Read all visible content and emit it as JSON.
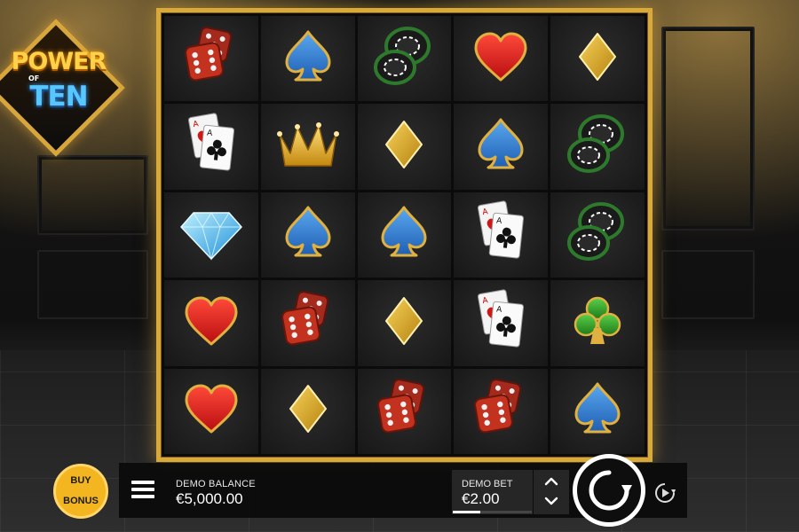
{
  "logo": {
    "line1": "POWER",
    "line2": "OF",
    "line3": "TEN"
  },
  "board": {
    "rows": [
      [
        "dice-icon",
        "spade-icon",
        "chips-icon",
        "heart-icon",
        "diamond-icon"
      ],
      [
        "cards-icon",
        "crown-icon",
        "diamond-icon",
        "spade-icon",
        "chips-icon"
      ],
      [
        "gem-icon",
        "spade-icon",
        "spade-icon",
        "cards-icon",
        "chips-icon"
      ],
      [
        "heart-icon",
        "dice-icon",
        "diamond-icon",
        "cards-icon",
        "club-icon"
      ],
      [
        "heart-icon",
        "diamond-icon",
        "dice-icon",
        "dice-icon",
        "spade-icon"
      ]
    ]
  },
  "buy_bonus": {
    "line1": "BUY",
    "line2": "BONUS"
  },
  "balance": {
    "label": "DEMO BALANCE",
    "value": "€5,000.00"
  },
  "bet": {
    "label": "DEMO BET",
    "value": "€2.00",
    "level_fraction": 0.35
  },
  "icons": {
    "menu": "hamburger-menu-icon",
    "bet_up": "chevron-up-icon",
    "bet_down": "chevron-down-icon",
    "spin": "spin-arrow-icon",
    "autoplay": "autoplay-icon"
  },
  "colors": {
    "frame_gold": "#d9a93a",
    "buy_bonus_yellow": "#f3b520",
    "spade_blue": "#3a86d6",
    "heart_red": "#d8191b",
    "club_green": "#2f9a2a"
  }
}
